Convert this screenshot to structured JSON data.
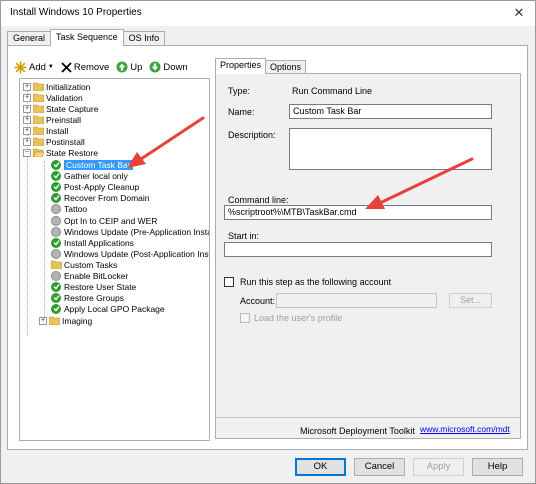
{
  "window": {
    "title": "Install Windows 10 Properties",
    "close_glyph": "✕"
  },
  "main_tabs": [
    {
      "label": "General"
    },
    {
      "label": "Task Sequence"
    },
    {
      "label": "OS Info"
    }
  ],
  "toolbar": {
    "add_label": "Add",
    "remove_label": "Remove",
    "up_label": "Up",
    "down_label": "Down"
  },
  "tree": {
    "nodes": [
      {
        "label": "Initialization",
        "type": "folder",
        "expander": "+"
      },
      {
        "label": "Validation",
        "type": "folder",
        "expander": "+"
      },
      {
        "label": "State Capture",
        "type": "folder",
        "expander": "+"
      },
      {
        "label": "Preinstall",
        "type": "folder",
        "expander": "+"
      },
      {
        "label": "Install",
        "type": "folder",
        "expander": "+"
      },
      {
        "label": "Postinstall",
        "type": "folder",
        "expander": "+"
      },
      {
        "label": "State Restore",
        "type": "folder",
        "expander": "−"
      },
      {
        "label": "Custom Task Bar",
        "type": "step-ok",
        "selected": true
      },
      {
        "label": "Gather local only",
        "type": "step-ok"
      },
      {
        "label": "Post-Apply Cleanup",
        "type": "step-ok"
      },
      {
        "label": "Recover From Domain",
        "type": "step-ok"
      },
      {
        "label": "Tattoo",
        "type": "step-gear"
      },
      {
        "label": "Opt In to CEIP and WER",
        "type": "step-gear"
      },
      {
        "label": "Windows Update (Pre-Application Installa",
        "type": "step-gear"
      },
      {
        "label": "Install Applications",
        "type": "step-ok"
      },
      {
        "label": "Windows Update (Post-Application Install",
        "type": "step-gear"
      },
      {
        "label": "Custom Tasks",
        "type": "folder"
      },
      {
        "label": "Enable BitLocker",
        "type": "step-gear"
      },
      {
        "label": "Restore User State",
        "type": "step-ok"
      },
      {
        "label": "Restore Groups",
        "type": "step-ok"
      },
      {
        "label": "Apply Local GPO Package",
        "type": "step-ok"
      },
      {
        "label": "Imaging",
        "type": "folder",
        "expander": "+"
      }
    ]
  },
  "props_tabs": [
    {
      "label": "Properties"
    },
    {
      "label": "Options"
    }
  ],
  "properties": {
    "type_label": "Type:",
    "type_value": "Run Command Line",
    "name_label": "Name:",
    "name_value": "Custom Task Bar",
    "description_label": "Description:",
    "description_value": "",
    "command_label": "Command line:",
    "command_value": "%scriptroot%\\MTB\\TaskBar.cmd",
    "startin_label": "Start in:",
    "startin_value": "",
    "runas_label": "Run this step as the following account",
    "account_label": "Account:",
    "account_value": "",
    "set_label": "Set...",
    "load_profile_label": "Load the user's profile",
    "mdt_text": "Microsoft Deployment Toolkit",
    "mdt_link": "www.microsoft.com/mdt"
  },
  "buttons": {
    "ok": "OK",
    "cancel": "Cancel",
    "apply": "Apply",
    "help": "Help"
  },
  "colors": {
    "selection": "#3399ff",
    "annotation_arrow": "#e8413c",
    "check_green": "#2e9b2e",
    "link": "#0000ee"
  }
}
